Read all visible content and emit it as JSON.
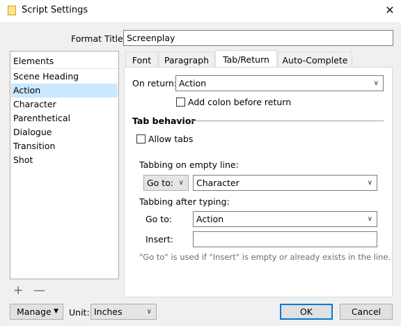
{
  "window": {
    "title": "Script Settings"
  },
  "format_title": {
    "label": "Format Title:",
    "value": "Screenplay"
  },
  "elements": {
    "header": "Elements",
    "items": [
      "Scene Heading",
      "Action",
      "Character",
      "Parenthetical",
      "Dialogue",
      "Transition",
      "Shot"
    ],
    "selected": "Action"
  },
  "tabs": [
    "Font",
    "Paragraph",
    "Tab/Return",
    "Auto-Complete"
  ],
  "active_tab": "Tab/Return",
  "on_return": {
    "label": "On return:",
    "value": "Action",
    "add_colon_label": "Add colon before return",
    "add_colon_checked": false
  },
  "tab_behavior": {
    "heading": "Tab behavior",
    "allow_tabs_label": "Allow tabs",
    "allow_tabs_checked": false,
    "empty_line": {
      "label": "Tabbing on empty line:",
      "action": "Go to:",
      "target": "Character"
    },
    "after_typing": {
      "label": "Tabbing after typing:",
      "goto_label": "Go to:",
      "goto_value": "Action",
      "insert_label": "Insert:",
      "insert_value": ""
    },
    "hint": "\"Go to\" is used if \"Insert\" is empty or already exists in the line."
  },
  "list_controls": {
    "add": "+",
    "remove": "—"
  },
  "footer": {
    "manage_label": "Manage",
    "unit_label": "Unit:",
    "unit_value": "Inches",
    "ok_label": "OK",
    "cancel_label": "Cancel"
  }
}
